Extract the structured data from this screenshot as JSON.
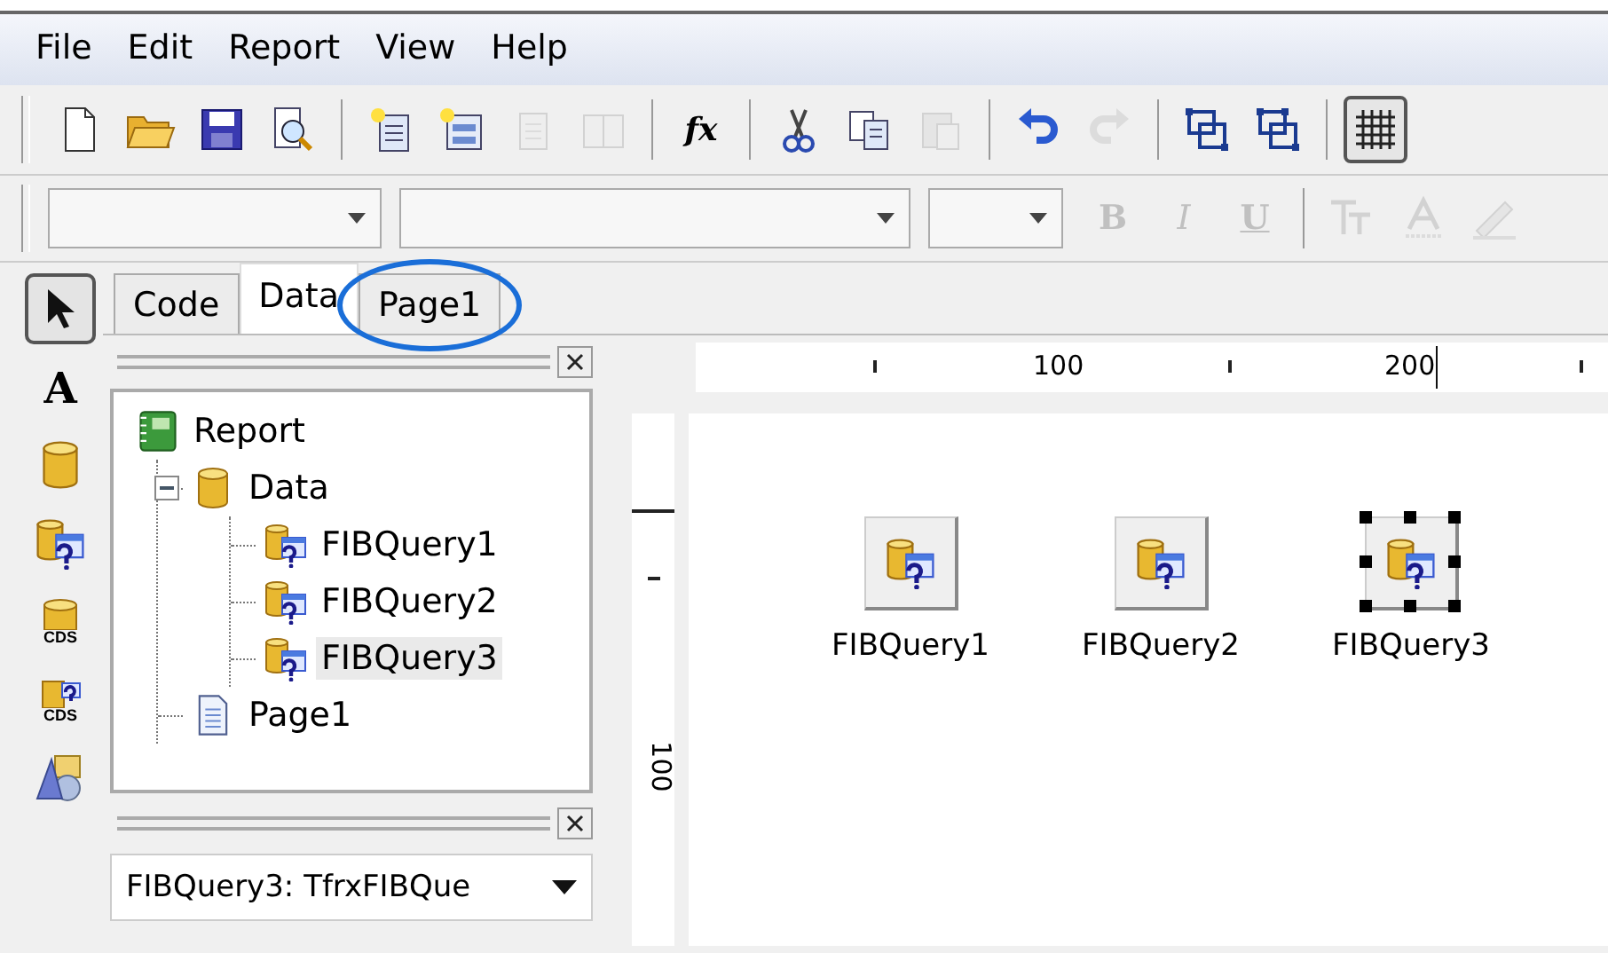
{
  "menu": [
    "File",
    "Edit",
    "Report",
    "View",
    "Help"
  ],
  "toolbar": [
    {
      "kind": "new",
      "disabled": false,
      "pressed": false
    },
    {
      "kind": "open",
      "disabled": false,
      "pressed": false
    },
    {
      "kind": "save",
      "disabled": false,
      "pressed": false
    },
    {
      "kind": "preview",
      "disabled": false,
      "pressed": false
    },
    {
      "kind": "separator"
    },
    {
      "kind": "new-page",
      "disabled": false,
      "pressed": false
    },
    {
      "kind": "new-dialog",
      "disabled": false,
      "pressed": false
    },
    {
      "kind": "delete-page",
      "disabled": true,
      "pressed": false
    },
    {
      "kind": "page-settings",
      "disabled": true,
      "pressed": false
    },
    {
      "kind": "separator"
    },
    {
      "kind": "glyph",
      "glyph": "fx",
      "disabled": false,
      "pressed": false
    },
    {
      "kind": "separator"
    },
    {
      "kind": "cut",
      "disabled": false,
      "pressed": false
    },
    {
      "kind": "copy",
      "disabled": false,
      "pressed": false
    },
    {
      "kind": "paste",
      "disabled": true,
      "pressed": false
    },
    {
      "kind": "separator"
    },
    {
      "kind": "undo",
      "disabled": false,
      "pressed": false
    },
    {
      "kind": "redo",
      "disabled": true,
      "pressed": false
    },
    {
      "kind": "separator"
    },
    {
      "kind": "group",
      "disabled": false,
      "pressed": false
    },
    {
      "kind": "ungroup",
      "disabled": false,
      "pressed": false
    },
    {
      "kind": "separator"
    },
    {
      "kind": "grid",
      "disabled": false,
      "pressed": true
    }
  ],
  "format_bar": [
    {
      "kind": "combo"
    },
    {
      "kind": "combo"
    },
    {
      "kind": "combo"
    },
    {
      "kind": "glyph",
      "glyph": "B",
      "disabled": true
    },
    {
      "kind": "glyph",
      "glyph": "I",
      "disabled": true
    },
    {
      "kind": "glyph",
      "glyph": "U",
      "disabled": true
    },
    {
      "kind": "separator"
    },
    {
      "kind": "font-size",
      "disabled": true
    },
    {
      "kind": "font-color",
      "disabled": true
    },
    {
      "kind": "highlight",
      "disabled": true
    }
  ],
  "tools": [
    {
      "kind": "select",
      "selected": true
    },
    {
      "kind": "glyph",
      "glyph": "A",
      "selected": false
    },
    {
      "kind": "database",
      "selected": false
    },
    {
      "kind": "query",
      "selected": false
    },
    {
      "kind": "cds",
      "label": "CDS",
      "selected": false
    },
    {
      "kind": "cds-query",
      "label": "CDS",
      "selected": false
    },
    {
      "kind": "shapes",
      "selected": false
    }
  ],
  "tabs": [
    {
      "label": "Code",
      "selected": false,
      "circled": false
    },
    {
      "label": "Data",
      "selected": true,
      "circled": false
    },
    {
      "label": "Page1",
      "selected": false,
      "circled": true
    }
  ],
  "tree": [
    {
      "label": "Report",
      "kind": "report",
      "selected": false,
      "children": [
        {
          "label": "Data",
          "kind": "database",
          "selected": false,
          "expanded": true,
          "children": [
            {
              "label": "FIBQuery1",
              "kind": "query",
              "selected": false
            },
            {
              "label": "FIBQuery2",
              "kind": "query",
              "selected": false
            },
            {
              "label": "FIBQuery3",
              "kind": "query",
              "selected": true
            }
          ]
        },
        {
          "label": "Page1",
          "kind": "page",
          "selected": false
        }
      ]
    }
  ],
  "object_selector": {
    "value": "FIBQuery3: TfrxFIBQue"
  },
  "ruler": {
    "top_labels": [
      "100",
      "200"
    ],
    "side_labels": [
      "100"
    ]
  },
  "components": [
    {
      "label": "FIBQuery1",
      "selected": false
    },
    {
      "label": "FIBQuery2",
      "selected": false
    },
    {
      "label": "FIBQuery3",
      "selected": true
    }
  ]
}
